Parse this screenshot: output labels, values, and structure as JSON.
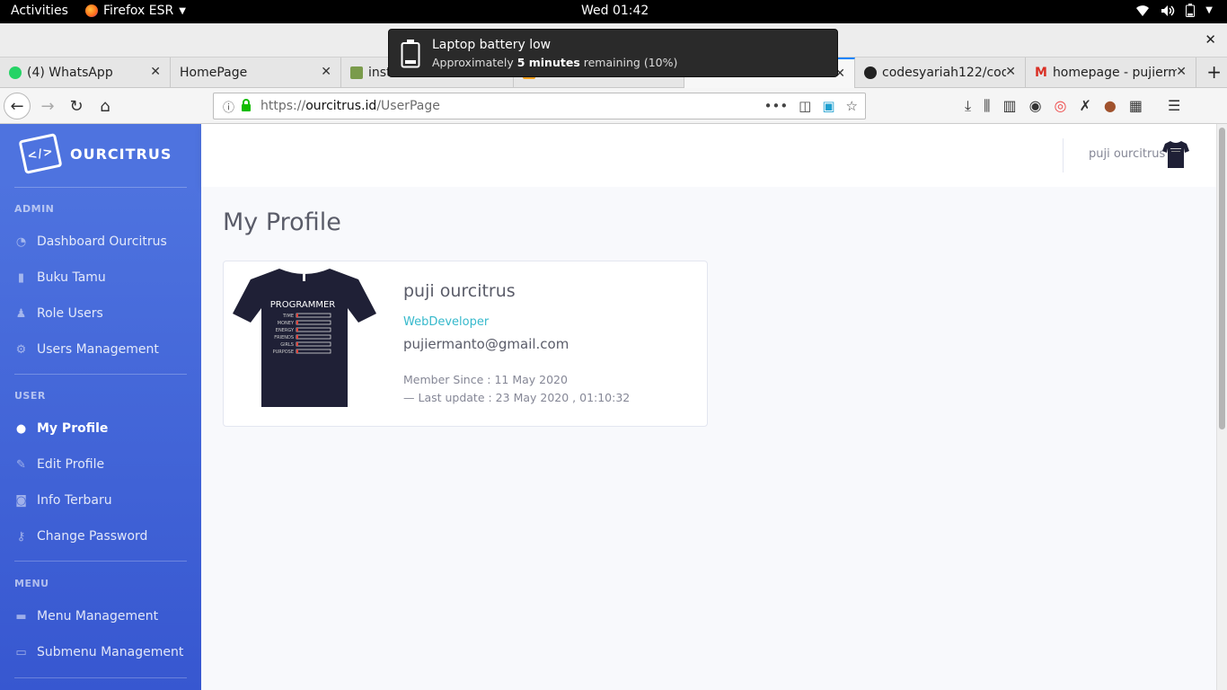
{
  "system": {
    "activities": "Activities",
    "app_name": "Firefox ESR",
    "clock": "Wed 01:42"
  },
  "notification": {
    "title": "Laptop battery low",
    "body_pre": "Approximately ",
    "body_bold": "5 minutes",
    "body_post": " remaining (10%)"
  },
  "tabs": [
    {
      "label": "(4) WhatsApp",
      "icon": "whatsapp-icon"
    },
    {
      "label": "HomePage",
      "icon": ""
    },
    {
      "label": "inst",
      "icon": "sheet-icon"
    },
    {
      "label": "",
      "icon": ""
    },
    {
      "label": "",
      "icon": ""
    },
    {
      "label": "codesyariah122/cod",
      "icon": "github-icon"
    },
    {
      "label": "homepage - pujierm",
      "icon": "gmail-icon"
    }
  ],
  "url": {
    "scheme": "https://",
    "domain": "ourcitrus.id",
    "path": "/UserPage"
  },
  "sidebar": {
    "brand": "OURCITRUS",
    "sections": [
      {
        "title": "ADMIN",
        "items": [
          {
            "label": "Dashboard Ourcitrus",
            "icon": "tachometer-icon"
          },
          {
            "label": "Buku Tamu",
            "icon": "book-icon"
          },
          {
            "label": "Role Users",
            "icon": "user-tie-icon"
          },
          {
            "label": "Users Management",
            "icon": "users-cog-icon"
          }
        ]
      },
      {
        "title": "USER",
        "items": [
          {
            "label": "My Profile",
            "icon": "user-icon",
            "active": true
          },
          {
            "label": "Edit Profile",
            "icon": "user-edit-icon"
          },
          {
            "label": "Info Terbaru",
            "icon": "camera-icon"
          },
          {
            "label": "Change Password",
            "icon": "key-icon"
          }
        ]
      },
      {
        "title": "MENU",
        "items": [
          {
            "label": "Menu Management",
            "icon": "folder-icon"
          },
          {
            "label": "Submenu Management",
            "icon": "folder-open-icon"
          }
        ]
      }
    ]
  },
  "topbar": {
    "username": "puji ourcitrus"
  },
  "page": {
    "title": "My Profile"
  },
  "profile": {
    "name": "puji ourcitrus",
    "role": "WebDeveloper",
    "email": "pujiermanto@gmail.com",
    "member_since": "Member Since : 11 May 2020",
    "last_update": "— Last update : 23 May 2020 , 01:10:32",
    "shirt_text": "PROGRAMMER",
    "shirt_bars": [
      "TIME",
      "MONEY",
      "ENERGY",
      "FRIENDS",
      "GIRLS",
      "PURPOSE"
    ]
  },
  "colors": {
    "sidebar_top": "#4e73df",
    "sidebar_bottom": "#3757d0",
    "role_text": "#36b9cc",
    "shirt": "#1f2036"
  }
}
